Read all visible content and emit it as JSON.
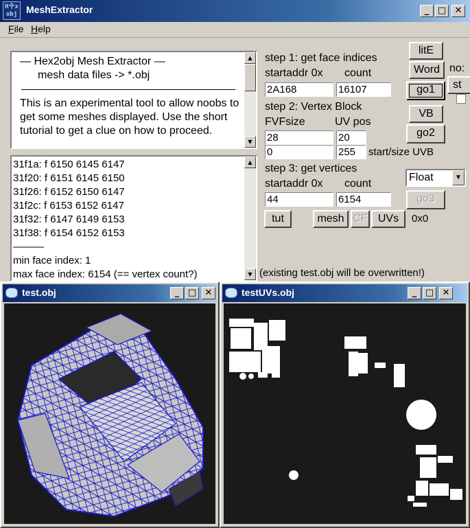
{
  "window": {
    "title": "MeshExtractor",
    "icon_lines": [
      "H㐃x",
      "obj"
    ],
    "minimize": "_",
    "maximize": "□",
    "close": "✕"
  },
  "menu": {
    "file": "File",
    "help": "Help"
  },
  "info": {
    "heading1": "—   Hex2obj Mesh Extractor   —",
    "heading2": "mesh data files -> *.obj",
    "body": "This is an experimental tool to allow noobs to get some meshes displayed. Use the short tutorial to get a clue on how to proceed."
  },
  "log": {
    "lines": [
      "31f1a: f  6150 6145 6147",
      "31f20: f  6151 6145 6150",
      "31f26: f  6152 6150 6147",
      "31f2c: f  6153 6152 6147",
      "31f32: f  6147 6149 6153",
      "31f38: f  6154 6152 6153"
    ],
    "separator": "———",
    "min_face": "min face index: 1",
    "max_face": "max face index: 6154 (== vertex count?)"
  },
  "step1": {
    "title": "step 1: get face indices",
    "startaddr_label": "startaddr 0x",
    "count_label": "count",
    "startaddr": "2A168",
    "count": "16107",
    "go_label": "go1"
  },
  "step2": {
    "title": "step 2: Vertex Block",
    "fvf_label": "FVFsize",
    "uvpos_label": "UV pos",
    "fvf": "28",
    "uvpos": "20",
    "uvb_start": "0",
    "uvb_size": "255",
    "uvb_label": "start/size UVB",
    "vb_label": "VB",
    "go_label": "go2"
  },
  "step3": {
    "title": "step 3: get vertices",
    "startaddr_label": "startaddr 0x",
    "count_label": "count",
    "startaddr": "44",
    "count": "6154",
    "type_selected": "Float",
    "go_label": "go3"
  },
  "side": {
    "lite_label": "litE",
    "word_label": "Word",
    "cut_no": "no:",
    "cut_st": "st"
  },
  "bottom": {
    "tut_label": "tut",
    "mesh_label": "mesh",
    "cf_label": "CF",
    "uvs_label": "UVs",
    "readout": "0x0",
    "overwrite_note": "(existing test.obj will be overwritten!)"
  },
  "child1": {
    "title": "test.obj"
  },
  "child2": {
    "title": "testUVs.obj"
  },
  "colors": {
    "titlebar": "#0a246a",
    "wireframe": "#1818c8",
    "mesh_fill": "#c8c8c8",
    "viewport_bg": "#1a1a1a"
  }
}
